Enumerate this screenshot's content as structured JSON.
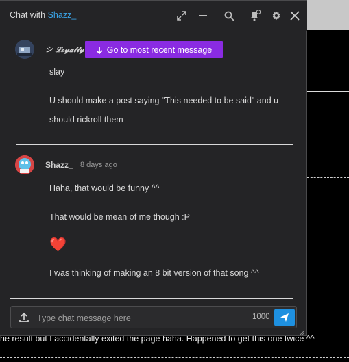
{
  "window": {
    "title_prefix": "Chat with",
    "title_user": "Shazz_"
  },
  "header_icons": [
    "expand-icon",
    "minimize-icon",
    "search-icon",
    "bell-icon",
    "gear-icon",
    "close-icon"
  ],
  "jump_button": {
    "label": "Go to most recent message"
  },
  "messages": [
    {
      "user": "シ 𝓛𝓸𝔂𝓪𝓵𝓽𝔂",
      "lines": [
        "slay",
        "U should make a post saying \"This needed to be said\" and u should rickroll them"
      ]
    },
    {
      "user": "Shazz_",
      "time": "8 days ago",
      "lines": [
        "Haha, that would be funny ^^",
        "That would be mean of me though :P",
        "❤️",
        "I was thinking of making an 8 bit version of that song ^^"
      ]
    }
  ],
  "composer": {
    "placeholder": "Type chat message here",
    "char_count": "1000"
  },
  "background": {
    "text": "he result but I accidentally exited the page haha. Happened to get this one twice ^^"
  },
  "colors": {
    "accent": "#8a2be2",
    "send": "#1e90e0",
    "link": "#3aa3e6",
    "panel": "#242426"
  }
}
